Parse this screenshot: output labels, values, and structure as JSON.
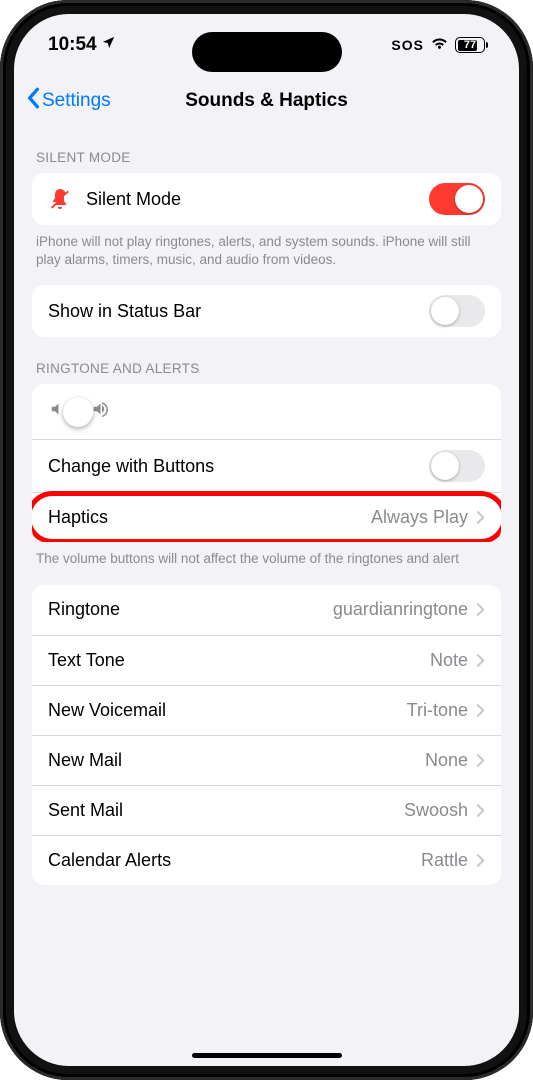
{
  "status": {
    "time": "10:54",
    "sos": "SOS",
    "battery_pct": 77
  },
  "nav": {
    "back": "Settings",
    "title": "Sounds & Haptics"
  },
  "silent": {
    "header": "SILENT MODE",
    "label": "Silent Mode",
    "on": true,
    "footer": "iPhone will not play ringtones, alerts, and system sounds. iPhone will still play alarms, timers, music, and audio from videos."
  },
  "statusbar_row": {
    "label": "Show in Status Bar",
    "on": false
  },
  "ringtone": {
    "header": "RINGTONE AND ALERTS",
    "volume_pct": 40,
    "change_buttons_label": "Change with Buttons",
    "change_buttons_on": false,
    "haptics_label": "Haptics",
    "haptics_value": "Always Play",
    "footer": "The volume buttons will not affect the volume of the ringtones and alert"
  },
  "sounds": {
    "ringtone": {
      "label": "Ringtone",
      "value": "guardianringtone"
    },
    "text_tone": {
      "label": "Text Tone",
      "value": "Note"
    },
    "new_voicemail": {
      "label": "New Voicemail",
      "value": "Tri-tone"
    },
    "new_mail": {
      "label": "New Mail",
      "value": "None"
    },
    "sent_mail": {
      "label": "Sent Mail",
      "value": "Swoosh"
    },
    "calendar_alerts": {
      "label": "Calendar Alerts",
      "value": "Rattle"
    }
  }
}
